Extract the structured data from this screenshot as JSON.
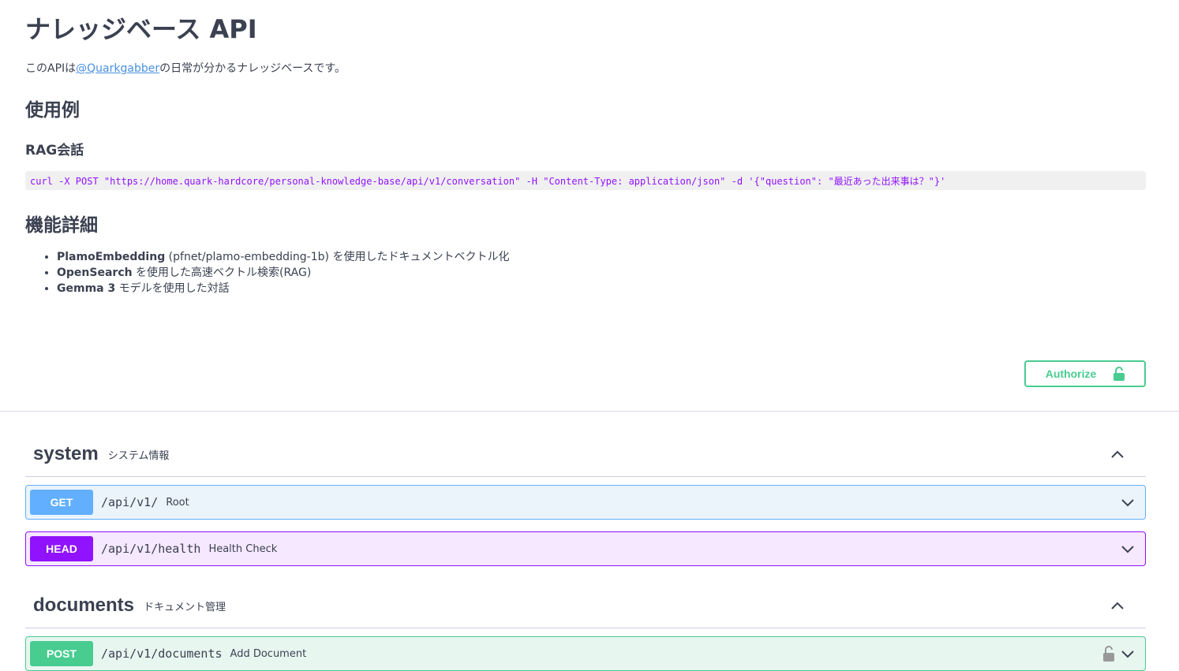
{
  "info": {
    "title": "ナレッジベース API",
    "description_prefix": "このAPIは",
    "description_link": "@Quarkgabber",
    "description_suffix": "の日常が分かるナレッジベースです。",
    "usage_heading": "使用例",
    "rag_heading": "RAG会話",
    "curl_example": "curl -X POST \"https://home.quark-hardcore/personal-knowledge-base/api/v1/conversation\"   -H \"Content-Type: application/json\"   -d '{\"question\": \"最近あった出来事は？\"}'",
    "features_heading": "機能詳細",
    "features": [
      {
        "bold": "PlamoEmbedding",
        "text": " (pfnet/plamo-embedding-1b) を使用したドキュメントベクトル化"
      },
      {
        "bold": "OpenSearch",
        "text": " を使用した高速ベクトル検索(RAG)"
      },
      {
        "bold": "Gemma 3",
        "text": " モデルを使用した対話"
      }
    ]
  },
  "authorize": {
    "label": "Authorize",
    "color": "#49cc90"
  },
  "tags": [
    {
      "name": "system",
      "description": "システム情報",
      "operations": [
        {
          "method": "GET",
          "path": "/api/v1/",
          "summary": "Root"
        },
        {
          "method": "HEAD",
          "path": "/api/v1/health",
          "summary": "Health Check"
        }
      ]
    },
    {
      "name": "documents",
      "description": "ドキュメント管理",
      "operations": [
        {
          "method": "POST",
          "path": "/api/v1/documents",
          "summary": "Add Document"
        }
      ]
    }
  ],
  "colors": {
    "get": "#61affe",
    "head": "#9012fe",
    "post": "#49cc90",
    "link": "#4990e2"
  }
}
